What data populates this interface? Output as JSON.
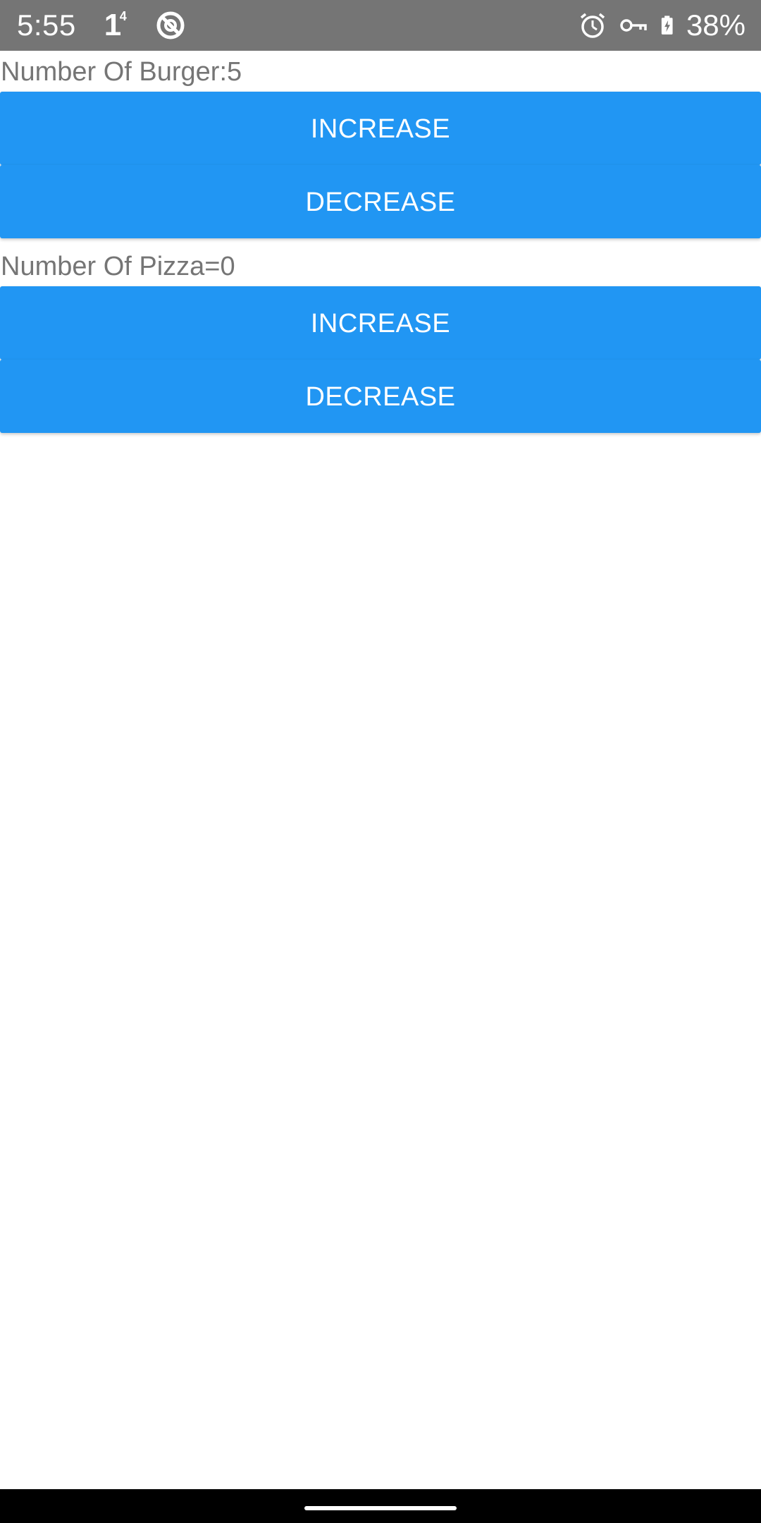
{
  "status_bar": {
    "time": "5:55",
    "notification_count": "1",
    "notification_sup": "4",
    "battery_percent": "38%",
    "icons": [
      "do-not-disturb-icon",
      "alarm-icon",
      "vpn-key-icon",
      "battery-charging-icon"
    ],
    "background_color": "#757575"
  },
  "burger": {
    "label": "Number Of Burger:5",
    "increase_label": "INCREASE",
    "decrease_label": "DECREASE"
  },
  "pizza": {
    "label": "Number Of Pizza=0",
    "increase_label": "INCREASE",
    "decrease_label": "DECREASE"
  },
  "colors": {
    "button": "#2196f3",
    "label_text": "#757575",
    "nav_bar": "#000000"
  }
}
